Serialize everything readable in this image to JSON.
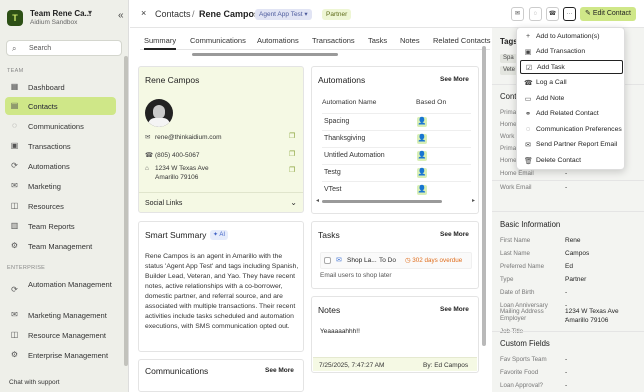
{
  "sidebar": {
    "workspace_initial": "T",
    "workspace_name": "Team Rene Ca...",
    "workspace_sub": "Aidium Sandbox",
    "search_label": "Search",
    "team_section": "TEAM",
    "team_items": [
      {
        "label": "Dashboard",
        "icon": "dashboard-icon"
      },
      {
        "label": "Contacts",
        "icon": "contacts-icon",
        "active": true
      },
      {
        "label": "Communications",
        "icon": "chat-icon"
      },
      {
        "label": "Transactions",
        "icon": "transactions-icon"
      },
      {
        "label": "Automations",
        "icon": "automations-icon"
      },
      {
        "label": "Marketing",
        "icon": "marketing-icon"
      },
      {
        "label": "Resources",
        "icon": "resources-icon"
      },
      {
        "label": "Team Reports",
        "icon": "reports-icon"
      },
      {
        "label": "Team Management",
        "icon": "gear-icon"
      }
    ],
    "enterprise_section": "ENTERPRISE",
    "enterprise_items": [
      {
        "label": "Automation Management",
        "icon": "automation-mgmt-icon"
      },
      {
        "label": "Marketing Management",
        "icon": "marketing-mgmt-icon"
      },
      {
        "label": "Resource Management",
        "icon": "resource-mgmt-icon"
      },
      {
        "label": "Enterprise Management",
        "icon": "gear-icon"
      }
    ],
    "chat_support": "Chat with support"
  },
  "header": {
    "close": "×",
    "crumb_root": "Contacts",
    "separator": "/",
    "crumb_current": "Rene Campos",
    "tag_primary": "Agent App Test",
    "tag_secondary": "Partner",
    "more_label": "···",
    "edit_label": "Edit Contact"
  },
  "tabs": [
    "Summary",
    "Communications",
    "Automations",
    "Transactions",
    "Tasks",
    "Notes",
    "Related Contacts"
  ],
  "profile": {
    "name": "Rene Campos",
    "email": "rene@thinkaidium.com",
    "phone": "(805) 400-5067",
    "address1": "1234 W Texas Ave",
    "address2": "Amarillo 79106",
    "social_links": "Social Links"
  },
  "smart_summary": {
    "title": "Smart Summary",
    "badge": "AI",
    "text": "Rene Campos is an agent in Amarillo with the status 'Agent App Test' and tags including Spanish, Builder Lead, Veteran, and Yao. They have recent notes, active relationships with a co-borrower, domestic partner, and referral source, and are associated with multiple transactions. Their recent activities include tasks scheduled and automation executions, with SMS communication opted out."
  },
  "communications": {
    "title": "Communications",
    "see_more": "See More"
  },
  "automations": {
    "title": "Automations",
    "see_more": "See More",
    "col_name": "Automation Name",
    "col_based": "Based On",
    "rows": [
      "Spacing",
      "Thanksgiving",
      "Untitled Automation",
      "Testg",
      "VTest"
    ]
  },
  "tasks": {
    "title": "Tasks",
    "see_more": "See More",
    "task_name": "Shop La...",
    "task_status": "To Do",
    "task_due": "302 days overdue",
    "task_desc": "Email users to shop later"
  },
  "notes": {
    "title": "Notes",
    "see_more": "See More",
    "text": "Yeaaaaahhh!!",
    "date": "7/25/2025, 7:47:27 AM",
    "by": "By: Ed Campos"
  },
  "right_panel": {
    "tags_title": "Tags",
    "tags": [
      "Spa",
      "Vete"
    ],
    "contact_title": "Conta",
    "contact_labels": [
      "Prima",
      "Home",
      "Work",
      "Prima",
      "Home"
    ],
    "home_email_label": "Home Email",
    "home_email_value": "-",
    "work_email_label": "Work Email",
    "work_email_value": "-",
    "basic_title": "Basic Information",
    "basic": [
      {
        "label": "First Name",
        "value": "Rene"
      },
      {
        "label": "Last Name",
        "value": "Campos"
      },
      {
        "label": "Preferred Name",
        "value": "Ed"
      },
      {
        "label": "Type",
        "value": "Partner"
      },
      {
        "label": "Date of Birth",
        "value": "-"
      },
      {
        "label": "Loan Anniversary",
        "value": "-"
      },
      {
        "label": "Employer",
        "value": "-"
      },
      {
        "label": "Job Title",
        "value": "-"
      }
    ],
    "mailing_label": "Mailing Address",
    "mailing_value1": "1234 W Texas Ave",
    "mailing_value2": "Amarillo 79106",
    "custom_title": "Custom Fields",
    "custom": [
      {
        "label": "Fav Sports Team",
        "value": "-"
      },
      {
        "label": "Favorite Food",
        "value": "-"
      },
      {
        "label": "Loan Approval?",
        "value": "-"
      }
    ]
  },
  "dropdown": {
    "items": [
      {
        "label": "Add to Automation(s)",
        "icon": "automation-icon"
      },
      {
        "label": "Add Transaction",
        "icon": "transaction-icon"
      },
      {
        "label": "Add Task",
        "icon": "task-icon",
        "highlighted": true
      },
      {
        "label": "Log a Call",
        "icon": "phone-icon"
      },
      {
        "label": "Add Note",
        "icon": "note-icon"
      },
      {
        "label": "Add Related Contact",
        "icon": "related-contact-icon"
      },
      {
        "label": "Communication Preferences",
        "icon": "preferences-icon"
      },
      {
        "label": "Send Partner Report Email",
        "icon": "email-icon"
      },
      {
        "label": "Delete Contact",
        "icon": "trash-icon"
      }
    ]
  },
  "colors": {
    "accent": "#cfe788",
    "brand_dark": "#2d5016",
    "overdue": "#e06d1c"
  }
}
